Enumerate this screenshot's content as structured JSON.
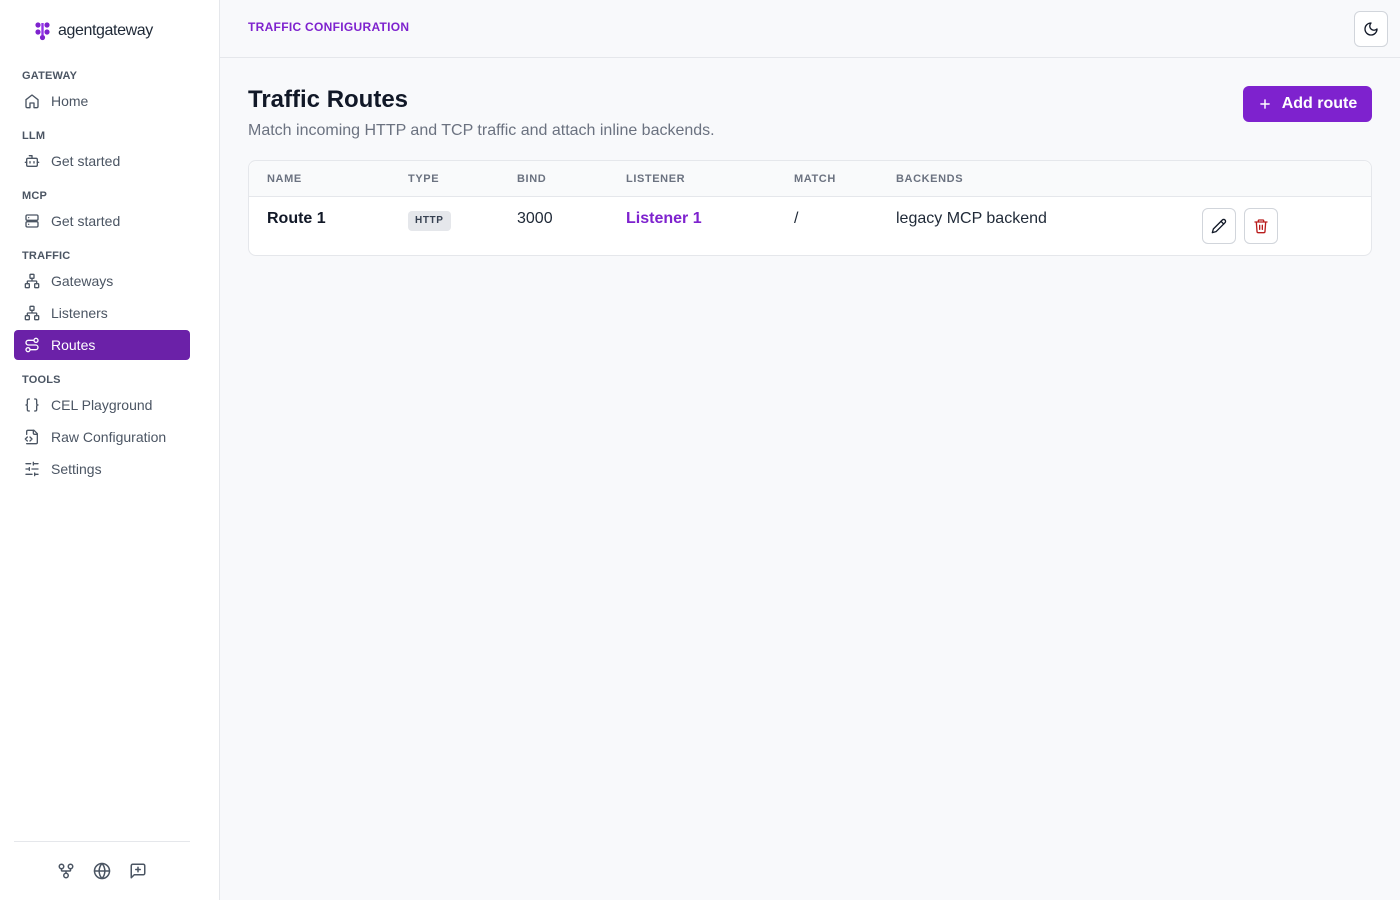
{
  "app": {
    "logo_text": "agentgateway"
  },
  "sidebar": {
    "sections": [
      {
        "label": "GATEWAY",
        "items": [
          {
            "label": "Home",
            "icon": "home-icon"
          }
        ]
      },
      {
        "label": "LLM",
        "items": [
          {
            "label": "Get started",
            "icon": "bot-icon"
          }
        ]
      },
      {
        "label": "MCP",
        "items": [
          {
            "label": "Get started",
            "icon": "server-icon"
          }
        ]
      },
      {
        "label": "TRAFFIC",
        "items": [
          {
            "label": "Gateways",
            "icon": "network-icon"
          },
          {
            "label": "Listeners",
            "icon": "network-icon"
          },
          {
            "label": "Routes",
            "icon": "route-icon",
            "active": true
          }
        ]
      },
      {
        "label": "TOOLS",
        "items": [
          {
            "label": "CEL Playground",
            "icon": "braces-icon"
          },
          {
            "label": "Raw Configuration",
            "icon": "file-code-icon"
          },
          {
            "label": "Settings",
            "icon": "sliders-icon"
          }
        ]
      }
    ],
    "footer_icons": [
      "git-fork-icon",
      "globe-icon",
      "feedback-icon"
    ]
  },
  "header": {
    "breadcrumb": "TRAFFIC CONFIGURATION",
    "theme_icon": "moon-icon"
  },
  "main": {
    "title": "Traffic Routes",
    "subtitle": "Match incoming HTTP and TCP traffic and attach inline backends.",
    "add_button": "Add route",
    "table": {
      "columns": [
        "NAME",
        "TYPE",
        "BIND",
        "LISTENER",
        "MATCH",
        "BACKENDS"
      ],
      "rows": [
        {
          "name": "Route 1",
          "type": "HTTP",
          "bind": "3000",
          "listener": "Listener 1",
          "match": "/",
          "backends": "legacy MCP backend"
        }
      ]
    }
  },
  "colors": {
    "accent": "#7e22ce",
    "active_nav": "#6b21a8",
    "danger": "#b91c1c"
  }
}
